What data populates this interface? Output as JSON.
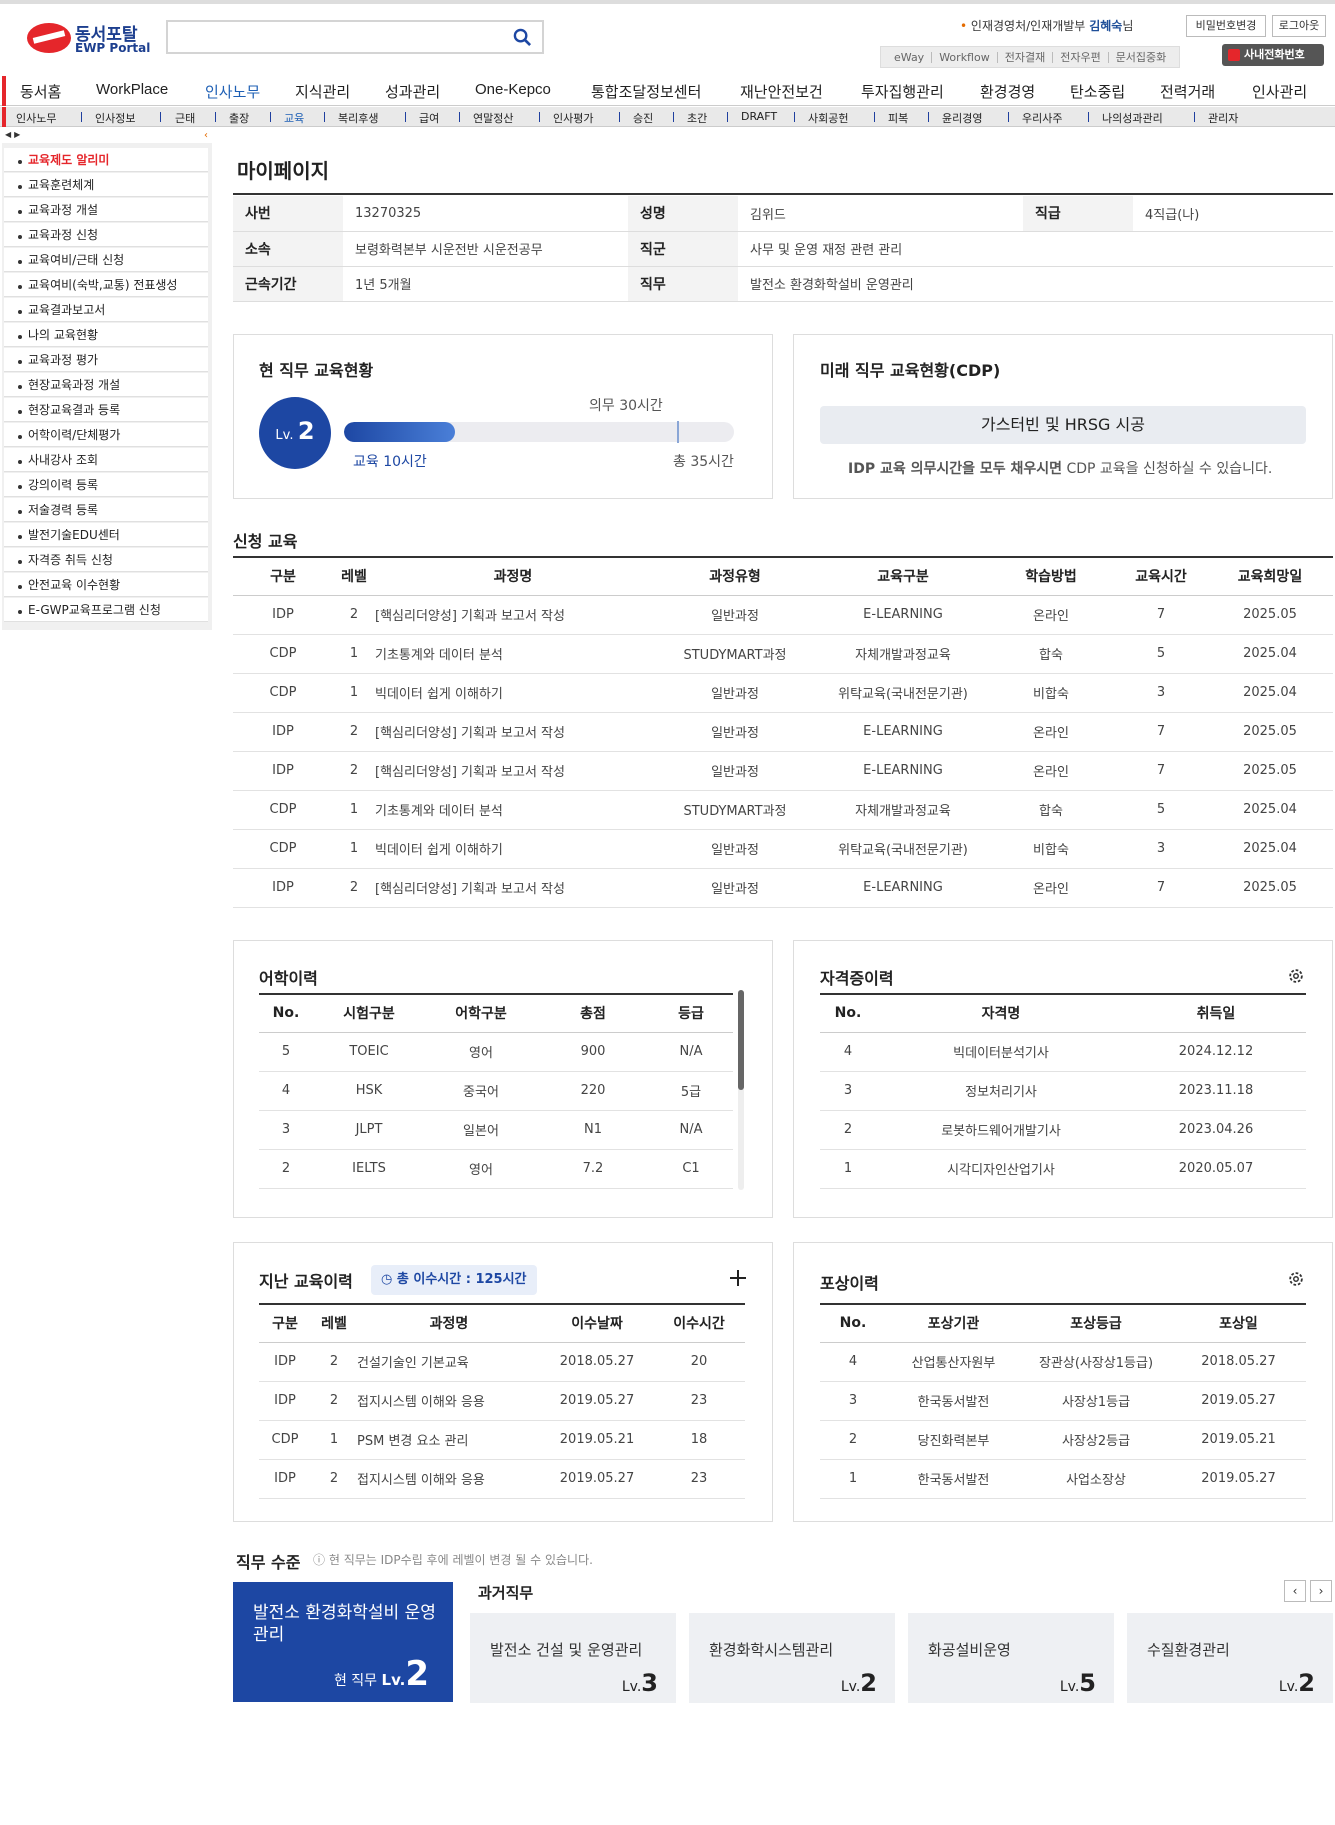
{
  "header": {
    "logo_korean": "동서포탈",
    "logo_english": "EWP Portal",
    "search_placeholder": "",
    "user_dept": "인재경영처/인재개발부",
    "user_name": "김혜숙",
    "user_suffix": "님",
    "change_password_label": "비밀번호변경",
    "logout_label": "로그아웃",
    "quick_links": [
      "eWay",
      "Workflow",
      "전자결재",
      "전자우편",
      "문서집중화"
    ],
    "phone_label": "사내전화번호"
  },
  "gnb": [
    "동서홈",
    "WorkPlace",
    "인사노무",
    "지식관리",
    "성과관리",
    "One-Kepco",
    "통합조달정보센터",
    "재난안전보건",
    "투자집행관리",
    "환경경영",
    "탄소중립",
    "전력거래",
    "인사관리"
  ],
  "gnb_active": "인사노무",
  "lnb": [
    "인사노무",
    "인사정보",
    "근태",
    "출장",
    "교육",
    "복리후생",
    "급여",
    "연말정산",
    "인사평가",
    "승진",
    "초간",
    "DRAFT",
    "사회공헌",
    "피복",
    "윤리경영",
    "우리사주",
    "나의성과관리",
    "관리자"
  ],
  "lnb_active": "교육",
  "sidebar": [
    "교육제도 알리미",
    "교육훈련체계",
    "교육과정 개설",
    "교육과정 신청",
    "교육여비/근태 신청",
    "교육여비(숙박,교통) 전표생성",
    "교육결과보고서",
    "나의 교육현황",
    "교육과정 평가",
    "현장교육과정 개설",
    "현장교육결과 등록",
    "어학이력/단체평가",
    "사내강사 조회",
    "강의이력 등록",
    "저술경력 등록",
    "발전기술EDU센터",
    "자격증 취득 신청",
    "안전교육 이수현황",
    "E-GWP교육프로그램 신청"
  ],
  "sidebar_active": "교육제도 알리미",
  "page_title": "마이페이지",
  "profile": {
    "emp_no_label": "사번",
    "emp_no": "13270325",
    "name_label": "성명",
    "name": "김위드",
    "grade_label": "직급",
    "grade": "4직급(나)",
    "dept_label": "소속",
    "dept": "보령화력본부 시운전반 시운전공무",
    "job_group_label": "직군",
    "job_group": "사무 및 운영 재정 관련 관리",
    "tenure_label": "근속기간",
    "tenure": "1년 5개월",
    "duty_label": "직무",
    "duty": "발전소 환경화학설비 운영관리"
  },
  "current_edu": {
    "title": "현 직무 교육현황",
    "lv_prefix": "Lv.",
    "level": "2",
    "required_label": "의무 30시간",
    "done_label": "교육 10시간",
    "total_label": "총 35시간",
    "done_hours": 10,
    "required_hours": 30,
    "total_hours": 35
  },
  "cdp": {
    "title": "미래 직무 교육현황(CDP)",
    "button_label": "가스터빈 및 HRSG 시공",
    "notice_bold": "IDP 교육 의무시간을 모두 채우시면",
    "notice_rest": " CDP 교육을 신청하실 수 있습니다."
  },
  "applied": {
    "title": "신청 교육",
    "headers": [
      "구분",
      "레벨",
      "과정명",
      "과정유형",
      "교육구분",
      "학습방법",
      "교육시간",
      "교육희망일"
    ],
    "rows": [
      [
        "IDP",
        "2",
        "[핵심리더양성] 기획과 보고서 작성",
        "일반과정",
        "E-LEARNING",
        "온라인",
        "7",
        "2025.05"
      ],
      [
        "CDP",
        "1",
        "기초통계와 데이터 분석",
        "STUDYMART과정",
        "자체개발과정교육",
        "합숙",
        "5",
        "2025.04"
      ],
      [
        "CDP",
        "1",
        "빅데이터 쉽게 이해하기",
        "일반과정",
        "위탁교육(국내전문기관)",
        "비합숙",
        "3",
        "2025.04"
      ],
      [
        "IDP",
        "2",
        "[핵심리더양성] 기획과 보고서 작성",
        "일반과정",
        "E-LEARNING",
        "온라인",
        "7",
        "2025.05"
      ],
      [
        "IDP",
        "2",
        "[핵심리더양성] 기획과 보고서 작성",
        "일반과정",
        "E-LEARNING",
        "온라인",
        "7",
        "2025.05"
      ],
      [
        "CDP",
        "1",
        "기초통계와 데이터 분석",
        "STUDYMART과정",
        "자체개발과정교육",
        "합숙",
        "5",
        "2025.04"
      ],
      [
        "CDP",
        "1",
        "빅데이터 쉽게 이해하기",
        "일반과정",
        "위탁교육(국내전문기관)",
        "비합숙",
        "3",
        "2025.04"
      ],
      [
        "IDP",
        "2",
        "[핵심리더양성] 기획과 보고서 작성",
        "일반과정",
        "E-LEARNING",
        "온라인",
        "7",
        "2025.05"
      ]
    ]
  },
  "language": {
    "title": "어학이력",
    "headers": [
      "No.",
      "시험구분",
      "어학구분",
      "총점",
      "등급"
    ],
    "rows": [
      [
        "5",
        "TOEIC",
        "영어",
        "900",
        "N/A"
      ],
      [
        "4",
        "HSK",
        "중국어",
        "220",
        "5급"
      ],
      [
        "3",
        "JLPT",
        "일본어",
        "N1",
        "N/A"
      ],
      [
        "2",
        "IELTS",
        "영어",
        "7.2",
        "C1"
      ]
    ]
  },
  "certs": {
    "title": "자격증이력",
    "headers": [
      "No.",
      "자격명",
      "취득일"
    ],
    "rows": [
      [
        "4",
        "빅데이터분석기사",
        "2024.12.12"
      ],
      [
        "3",
        "정보처리기사",
        "2023.11.18"
      ],
      [
        "2",
        "로봇하드웨어개발기사",
        "2023.04.26"
      ],
      [
        "1",
        "시각디자인산업기사",
        "2020.05.07"
      ]
    ]
  },
  "past_edu": {
    "title": "지난 교육이력",
    "badge": "총 이수시간 : 125시간",
    "headers": [
      "구분",
      "레벨",
      "과정명",
      "이수날짜",
      "이수시간"
    ],
    "rows": [
      [
        "IDP",
        "2",
        "건설기술인 기본교육",
        "2018.05.27",
        "20"
      ],
      [
        "IDP",
        "2",
        "접지시스템 이해와 응용",
        "2019.05.27",
        "23"
      ],
      [
        "CDP",
        "1",
        "PSM 변경 요소 관리",
        "2019.05.21",
        "18"
      ],
      [
        "IDP",
        "2",
        "접지시스템 이해와 응용",
        "2019.05.27",
        "23"
      ]
    ]
  },
  "awards": {
    "title": "포상이력",
    "headers": [
      "No.",
      "포상기관",
      "포상등급",
      "포상일"
    ],
    "rows": [
      [
        "4",
        "산업통산자원부",
        "장관상(사장상1등급)",
        "2018.05.27"
      ],
      [
        "3",
        "한국동서발전",
        "사장상1등급",
        "2019.05.27"
      ],
      [
        "2",
        "당진화력본부",
        "사장상2등급",
        "2019.05.21"
      ],
      [
        "1",
        "한국동서발전",
        "사업소장상",
        "2019.05.27"
      ]
    ]
  },
  "job_level": {
    "title": "직무 수준",
    "notice": "현 직무는 IDP수립 후에 레벨이 변경 될 수 있습니다.",
    "current_name": "발전소 환경화학설비 운영관리",
    "current_prefix": "현 직무",
    "lv_prefix": "Lv.",
    "current_level": "2",
    "past_title": "과거직무",
    "past": [
      {
        "name": "발전소 건설 및 운영관리",
        "level": "3"
      },
      {
        "name": "환경화학시스템관리",
        "level": "2"
      },
      {
        "name": "화공설비운영",
        "level": "5"
      },
      {
        "name": "수질환경관리",
        "level": "2"
      }
    ]
  },
  "colors": {
    "brand_red": "#e5262b",
    "accent_blue": "#1d47a3",
    "link_blue": "#1f60b5"
  }
}
